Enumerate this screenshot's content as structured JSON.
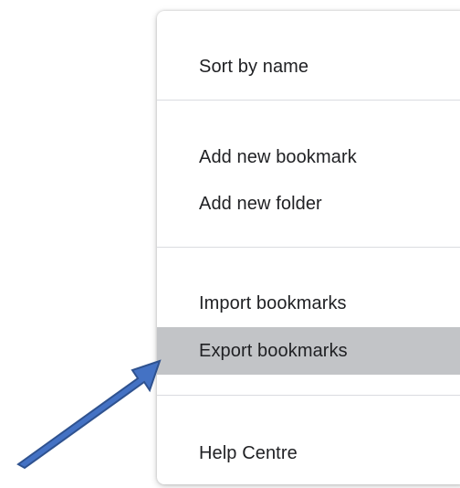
{
  "menu": {
    "items": [
      {
        "label": "Sort by name"
      },
      {
        "label": "Add new bookmark"
      },
      {
        "label": "Add new folder"
      },
      {
        "label": "Import bookmarks"
      },
      {
        "label": "Export bookmarks",
        "highlighted": true
      },
      {
        "label": "Help Centre"
      }
    ]
  },
  "colors": {
    "highlight": "#c2c4c7",
    "text": "#202124",
    "separator": "#dadce0",
    "annotation_arrow": "#4472c4"
  },
  "annotation": {
    "icon": "arrow-pointer-icon"
  }
}
